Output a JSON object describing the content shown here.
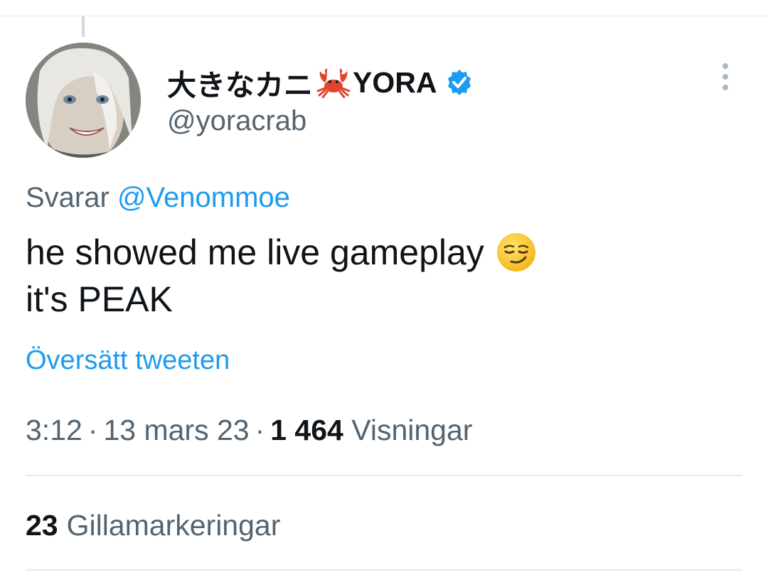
{
  "tweet": {
    "author": {
      "display_name": "大きなカニ",
      "display_name_suffix": "YORA",
      "handle": "@yoracrab",
      "avatar_icon": "avatar-image",
      "name_emoji_icon": "crab-icon",
      "verified_icon": "verified-badge-icon",
      "verified_color": "#1d9bf0"
    },
    "reply": {
      "prefix": "Svarar",
      "mention": "@Venommoe"
    },
    "text_lines": [
      "he showed me live gameplay",
      "it's PEAK"
    ],
    "text_emoji_icon": "smirking-face-icon",
    "translate_label": "Översätt tweeten",
    "time": "3:12",
    "date": "13 mars 23",
    "views_count": "1 464",
    "views_label": "Visningar",
    "separator": "·",
    "likes_count": "23",
    "likes_label": "Gillamarkeringar"
  },
  "colors": {
    "accent": "#1d9bf0",
    "text_primary": "#0f1419",
    "text_secondary": "#536471",
    "divider": "#e6e9ec"
  }
}
